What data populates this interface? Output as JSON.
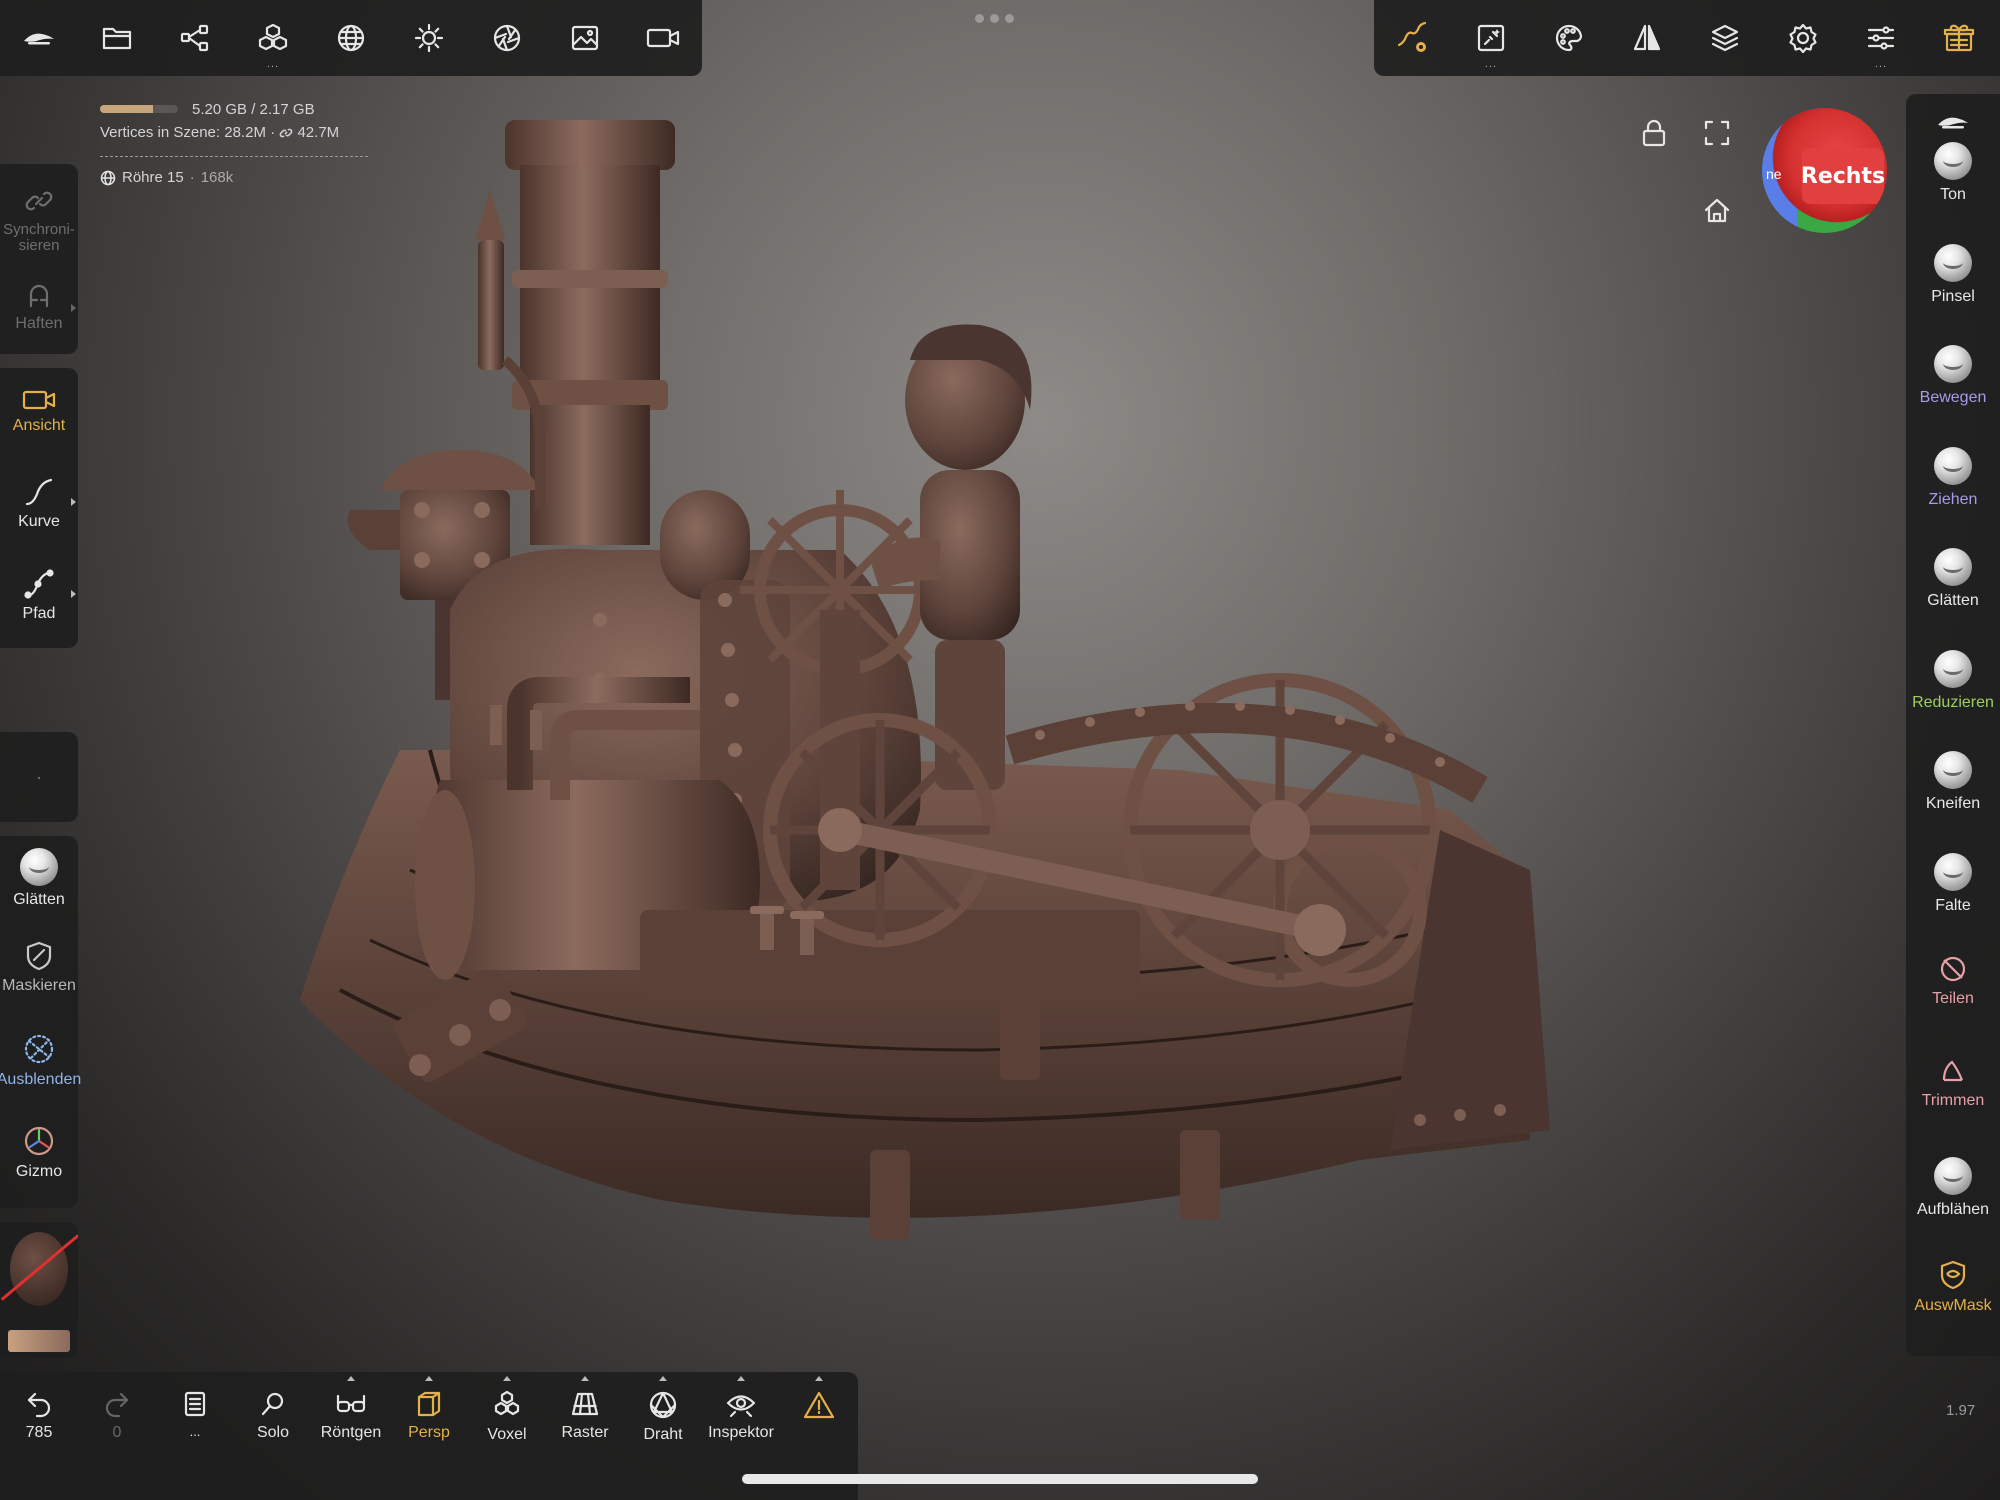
{
  "topbar_left": {
    "icons": [
      "nomad-logo-icon",
      "folder-icon",
      "share-icon",
      "cubes-icon",
      "sphere-grid-icon",
      "sun-icon",
      "aperture-icon",
      "image-icon",
      "video-camera-icon"
    ],
    "cubes_dots": "..."
  },
  "topbar_right": {
    "icons": [
      "stroke-icon",
      "texture-icon",
      "palette-icon",
      "symmetry-icon",
      "layers-icon",
      "gear-icon",
      "sliders-icon",
      "gift-icon"
    ],
    "texture_dots": "...",
    "sliders_dots": "..."
  },
  "info": {
    "memory": "5.20 GB / 2.17 GB",
    "memory_usage_fraction": 0.68,
    "vertices_label": "Vertices in Szene",
    "vertices_value": "28.2M",
    "vertices_linked": "42.7M",
    "object_name": "Röhre 15",
    "object_count": "168k"
  },
  "view_cube": {
    "face_label": "Rechts",
    "side_label": "ne"
  },
  "left_panel": {
    "items": [
      {
        "label": "Synchroni­sieren",
        "state": "disabled"
      },
      {
        "label": "Haften",
        "state": "disabled"
      },
      {
        "label": "Ansicht",
        "state": "active"
      },
      {
        "label": "Kurve",
        "state": "normal"
      },
      {
        "label": "Pfad",
        "state": "normal"
      },
      {
        "label": "Glätten",
        "state": "normal"
      },
      {
        "label": "Maskieren",
        "state": "normal"
      },
      {
        "label": "Ausblenden",
        "state": "highlight"
      },
      {
        "label": "Gizmo",
        "state": "normal"
      }
    ],
    "spacer_dot": "·"
  },
  "brushes": [
    {
      "label": "Ton",
      "color": "white"
    },
    {
      "label": "Pinsel",
      "color": "white"
    },
    {
      "label": "Bewegen",
      "color": "purple"
    },
    {
      "label": "Ziehen",
      "color": "purple"
    },
    {
      "label": "Glätten",
      "color": "white"
    },
    {
      "label": "Reduzieren",
      "color": "green"
    },
    {
      "label": "Kneifen",
      "color": "white"
    },
    {
      "label": "Falte",
      "color": "white"
    },
    {
      "label": "Teilen",
      "color": "pink"
    },
    {
      "label": "Trimmen",
      "color": "pink"
    },
    {
      "label": "Aufblähen",
      "color": "white"
    },
    {
      "label": "AuswMask",
      "color": "orange"
    }
  ],
  "bottombar": {
    "undo_count": "785",
    "redo_count": "0",
    "history_dots": "...",
    "items": [
      "Solo",
      "Röntgen",
      "Persp",
      "Voxel",
      "Raster",
      "Draht",
      "Inspektor"
    ]
  },
  "zoom": "1.97",
  "colors": {
    "accent": "#e4b04a",
    "panel": "#1e1e1e",
    "material": "#6e4f44"
  }
}
